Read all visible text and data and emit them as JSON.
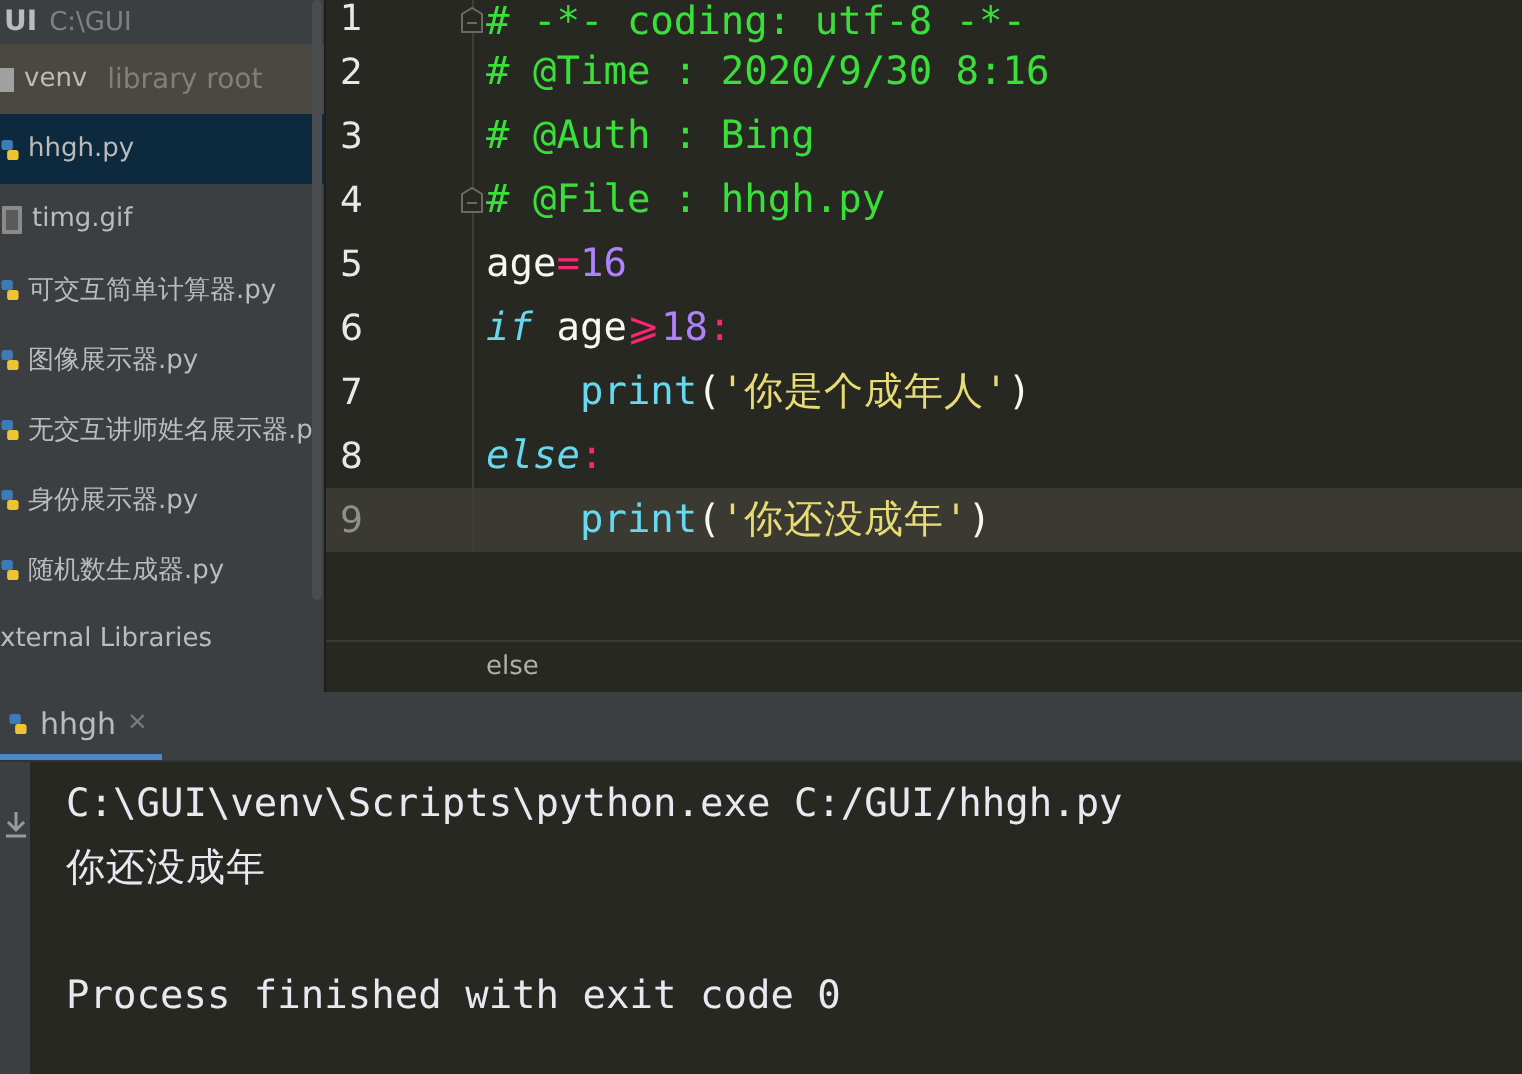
{
  "project": {
    "root_name": "UI",
    "root_path": "C:\\GUI",
    "items": [
      {
        "kind": "folder",
        "name": "venv",
        "hint": "library root",
        "selected": false,
        "highlighted": true
      },
      {
        "kind": "python",
        "name": "hhgh.py",
        "selected": true,
        "highlighted": false
      },
      {
        "kind": "image",
        "name": "timg.gif",
        "selected": false,
        "highlighted": false
      },
      {
        "kind": "python",
        "name": "可交互简单计算器.py",
        "selected": false,
        "highlighted": false
      },
      {
        "kind": "python",
        "name": "图像展示器.py",
        "selected": false,
        "highlighted": false
      },
      {
        "kind": "python",
        "name": "无交互讲师姓名展示器.p",
        "selected": false,
        "highlighted": false
      },
      {
        "kind": "python",
        "name": "身份展示器.py",
        "selected": false,
        "highlighted": false
      },
      {
        "kind": "python",
        "name": "随机数生成器.py",
        "selected": false,
        "highlighted": false
      },
      {
        "kind": "library",
        "name": "xternal Libraries",
        "selected": false,
        "highlighted": false
      }
    ]
  },
  "editor": {
    "lines": [
      {
        "number": "1",
        "fold": true,
        "current": false,
        "tokens": [
          {
            "kind": "comment",
            "text": "# -*- coding: utf-8 -*-"
          }
        ]
      },
      {
        "number": "2",
        "fold": false,
        "current": false,
        "tokens": [
          {
            "kind": "comment",
            "text": "# @Time : 2020/9/30 8:16"
          }
        ]
      },
      {
        "number": "3",
        "fold": false,
        "current": false,
        "tokens": [
          {
            "kind": "comment",
            "text": "# @Auth : Bing"
          }
        ]
      },
      {
        "number": "4",
        "fold": true,
        "current": false,
        "tokens": [
          {
            "kind": "comment",
            "text": "# @File : hhgh.py"
          }
        ]
      },
      {
        "number": "5",
        "fold": false,
        "current": false,
        "tokens": [
          {
            "kind": "name",
            "text": "age"
          },
          {
            "kind": "operator",
            "text": "="
          },
          {
            "kind": "number",
            "text": "16"
          }
        ]
      },
      {
        "number": "6",
        "fold": false,
        "current": false,
        "tokens": [
          {
            "kind": "keyword",
            "text": "if"
          },
          {
            "kind": "name",
            "text": " age"
          },
          {
            "kind": "operator",
            "text": "⩾"
          },
          {
            "kind": "number",
            "text": "18"
          },
          {
            "kind": "operator",
            "text": ":"
          }
        ]
      },
      {
        "number": "7",
        "fold": false,
        "current": false,
        "tokens": [
          {
            "kind": "function",
            "text": "    print"
          },
          {
            "kind": "paren",
            "text": "("
          },
          {
            "kind": "string",
            "text": "'你是个成年人'"
          },
          {
            "kind": "paren",
            "text": ")"
          }
        ]
      },
      {
        "number": "8",
        "fold": false,
        "current": false,
        "tokens": [
          {
            "kind": "keyword",
            "text": "else"
          },
          {
            "kind": "operator",
            "text": ":"
          }
        ]
      },
      {
        "number": "9",
        "fold": false,
        "current": true,
        "tokens": [
          {
            "kind": "function",
            "text": "    print"
          },
          {
            "kind": "paren",
            "text": "("
          },
          {
            "kind": "string",
            "text": "'你还没成年'"
          },
          {
            "kind": "paren",
            "text": ")"
          }
        ]
      }
    ],
    "breadcrumb": "else"
  },
  "run": {
    "tabs": [
      {
        "label": "hhgh",
        "selected": true,
        "close": "×"
      }
    ],
    "output_blocks": [
      [
        "C:\\GUI\\venv\\Scripts\\python.exe C:/GUI/hhgh.py",
        "你还没成年"
      ],
      [
        "Process finished with exit code 0"
      ]
    ]
  }
}
